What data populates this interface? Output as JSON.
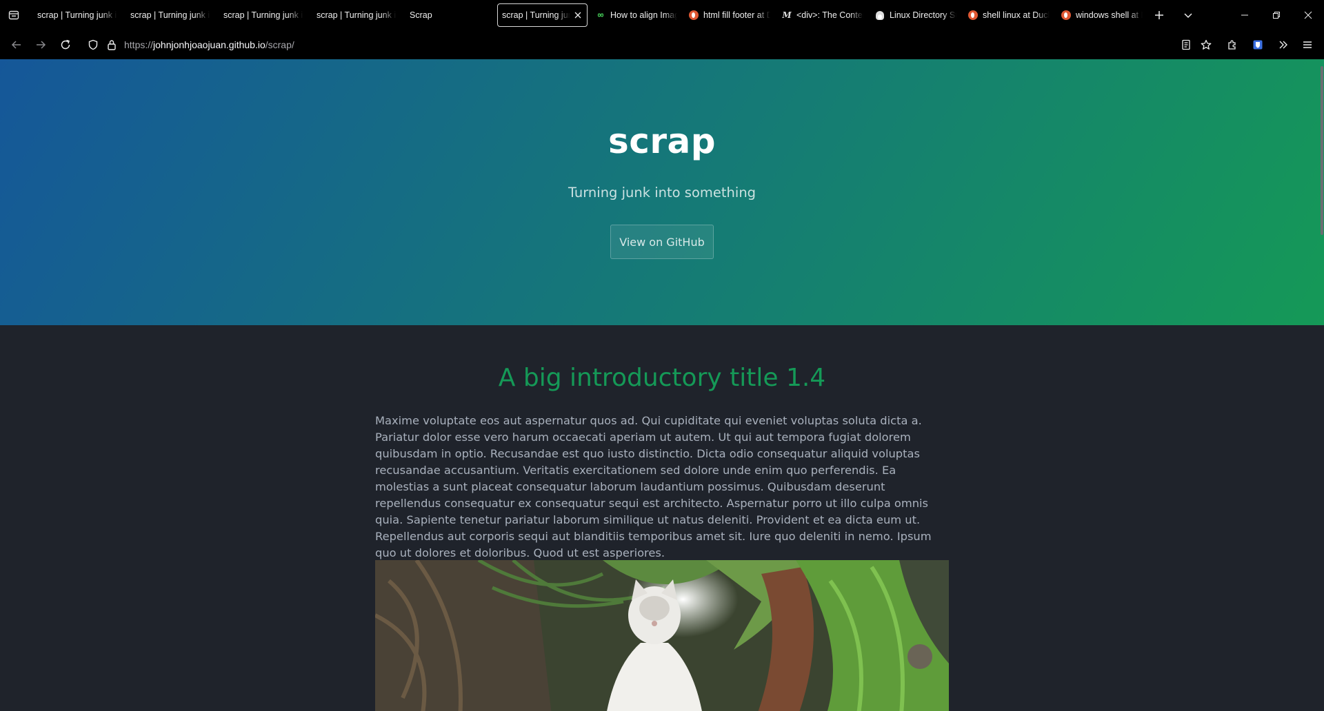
{
  "browser": {
    "tabs": [
      {
        "title": "scrap | Turning junk into something",
        "active": false
      },
      {
        "title": "scrap | Turning junk into something",
        "active": false
      },
      {
        "title": "scrap | Turning junk into something",
        "active": false
      },
      {
        "title": "scrap | Turning junk into something",
        "active": false
      },
      {
        "title": "Scrap",
        "active": false
      },
      {
        "title": "scrap | Turning junk into something",
        "active": true
      },
      {
        "title": "How to align Image",
        "active": false
      },
      {
        "title": "html fill footer at DuckDuckGo",
        "active": false
      },
      {
        "title": "<div>: The Content Division element",
        "active": false
      },
      {
        "title": "Linux Directory Structure",
        "active": false
      },
      {
        "title": "shell linux at DuckDuckGo",
        "active": false
      },
      {
        "title": "windows shell at DuckDuckGo",
        "active": false
      }
    ],
    "url": {
      "protocol": "https://",
      "host": "johnjonhjoaojuan.github.io",
      "path": "/scrap/"
    }
  },
  "page": {
    "hero": {
      "title": "scrap",
      "tagline": "Turning junk into something",
      "button_label": "View on GitHub"
    },
    "main": {
      "heading": "A big introductory title 1.4",
      "paragraph": "Maxime voluptate eos aut aspernatur quos ad. Qui cupiditate qui eveniet voluptas soluta dicta a. Pariatur dolor esse vero harum occaecati aperiam ut autem. Ut qui aut tempora fugiat dolorem quibusdam in optio. Recusandae est quo iusto distinctio. Dicta odio consequatur aliquid voluptas recusandae accusantium. Veritatis exercitationem sed dolore unde enim quo perferendis. Ea molestias a sunt placeat consequatur laborum laudantium possimus. Quibusdam deserunt repellendus consequatur ex consequatur sequi est architecto. Aspernatur porro ut illo culpa omnis quia. Sapiente tenetur pariatur laborum similique ut natus deleniti. Provident et ea dicta eum ut. Repellendus aut corporis sequi aut blanditiis temporibus amet sit. Iure quo deleniti in nemo. Ipsum quo ut dolores et doloribus. Quod ut est asperiores."
    }
  },
  "colors": {
    "hero_start": "#155799",
    "hero_end": "#159957",
    "heading": "#159957",
    "body_bg": "#1f232b",
    "text": "#a9b1bd"
  }
}
